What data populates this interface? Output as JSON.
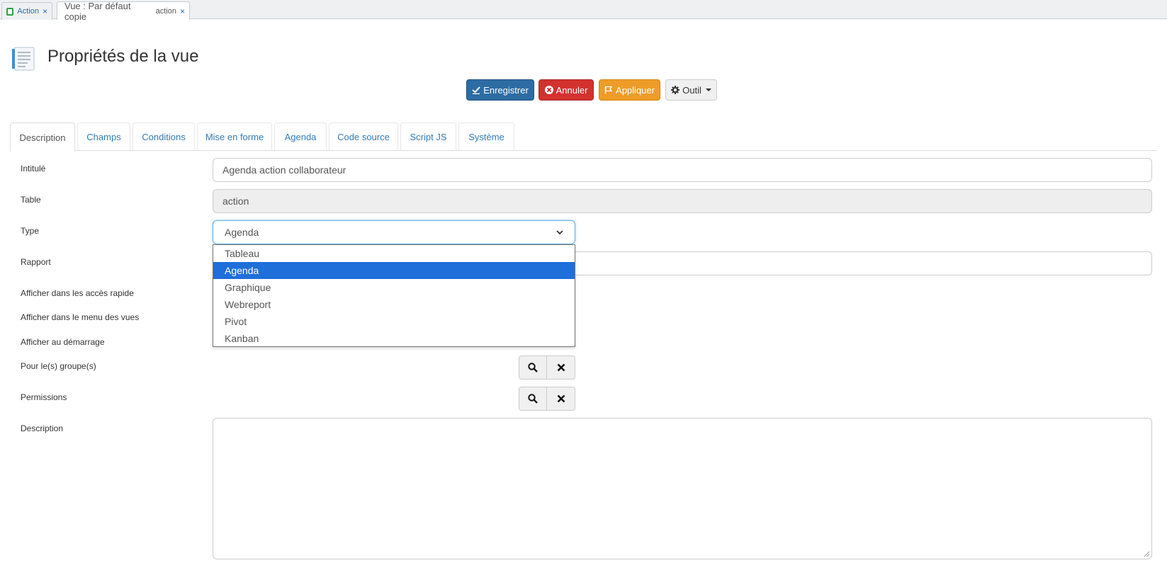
{
  "window_tabs": [
    {
      "label": "Action",
      "sub": ""
    },
    {
      "label": "Vue : Par défaut copie",
      "sub": "action"
    }
  ],
  "close_glyph": "×",
  "header": {
    "title": "Propriétés de la vue"
  },
  "toolbar": {
    "save_label": "Enregistrer",
    "cancel_label": "Annuler",
    "apply_label": "Appliquer",
    "tool_label": "Outil"
  },
  "tabs": [
    "Description",
    "Champs",
    "Conditions",
    "Mise en forme",
    "Agenda",
    "Code source",
    "Script JS",
    "Système"
  ],
  "active_tab": "Description",
  "form": {
    "labels": {
      "intitule": "Intitulé",
      "table": "Table",
      "type": "Type",
      "rapport": "Rapport",
      "acces_rapide": "Afficher dans les accès rapide",
      "menu_vues": "Afficher dans le menu des vues",
      "demarrage": "Afficher au démarrage",
      "groupes": "Pour le(s) groupe(s)",
      "permissions": "Permissions",
      "description": "Description"
    },
    "intitule_value": "Agenda action collaborateur",
    "table_value": "action",
    "type_value": "Agenda",
    "type_options": [
      "Tableau",
      "Agenda",
      "Graphique",
      "Webreport",
      "Pivot",
      "Kanban"
    ],
    "type_selected_index": 1
  },
  "icons": {
    "page": "document-list-icon",
    "save": "save-check-icon",
    "cancel": "close-circle-icon",
    "apply": "apply-flag-icon",
    "tool": "gear-icon",
    "search": "search-icon",
    "clear": "clear-x-icon"
  },
  "colors": {
    "primary": "#2d6ca2",
    "danger": "#d2322d",
    "warning": "#ed9c28",
    "link": "#337ab7",
    "selected_option": "#1e6fd9"
  }
}
